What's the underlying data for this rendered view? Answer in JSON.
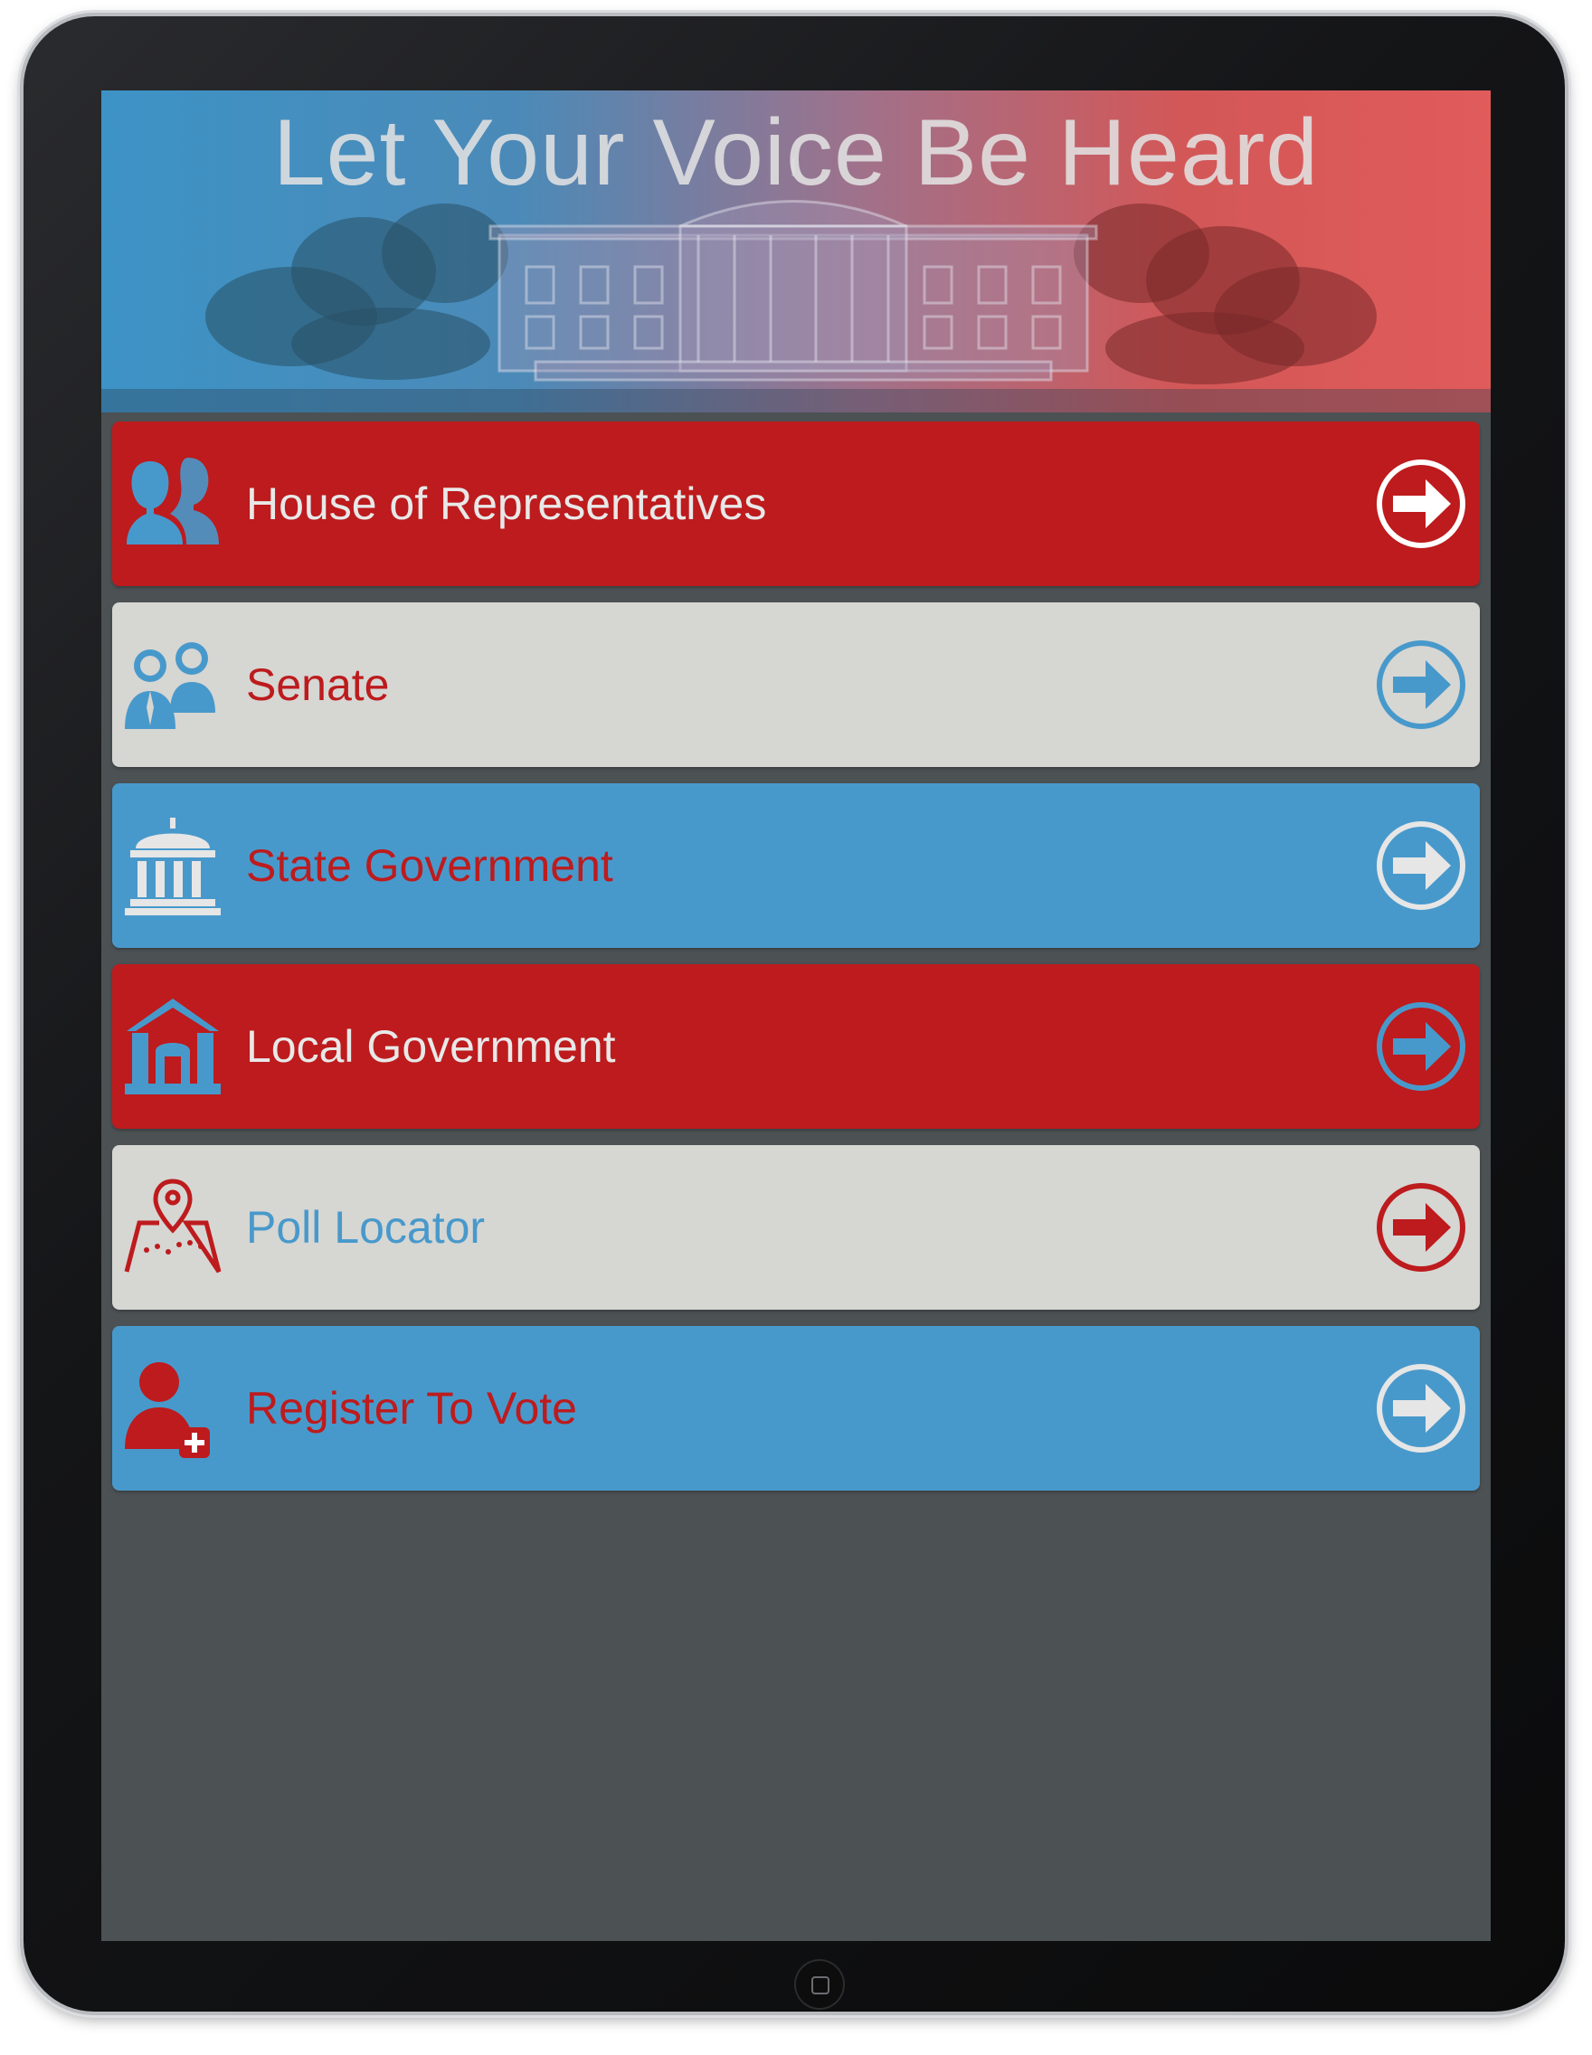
{
  "header": {
    "title": "Let Your Voice Be Heard"
  },
  "menu": [
    {
      "label": "House of Representatives",
      "icon": "group-people-icon",
      "bg": "#bd1b1d",
      "text_color": "#e8e8e8",
      "icon_color": "#4899cb",
      "arrow_color": "#ffffff"
    },
    {
      "label": "Senate",
      "icon": "senators-icon",
      "bg": "#d6d6d3",
      "text_color": "#bd1b1d",
      "icon_color": "#4899cb",
      "arrow_color": "#4899cb"
    },
    {
      "label": "State Government",
      "icon": "capitol-building-icon",
      "bg": "#4899cb",
      "text_color": "#bd1b1d",
      "icon_color": "#e6e6e6",
      "arrow_color": "#e6e6e6"
    },
    {
      "label": "Local Government",
      "icon": "town-hall-icon",
      "bg": "#bd1b1d",
      "text_color": "#e8e8e8",
      "icon_color": "#4899cb",
      "arrow_color": "#4899cb"
    },
    {
      "label": "Poll Locator",
      "icon": "map-pin-icon",
      "bg": "#d6d6d3",
      "text_color": "#4899cb",
      "icon_color": "#bd1b1d",
      "arrow_color": "#bd1b1d"
    },
    {
      "label": "Register To Vote",
      "icon": "add-user-icon",
      "bg": "#4899cb",
      "text_color": "#bd1b1d",
      "icon_color": "#bd1b1d",
      "arrow_color": "#e6e6e6"
    }
  ],
  "device": {
    "home_button_icon": "home-button-icon"
  }
}
